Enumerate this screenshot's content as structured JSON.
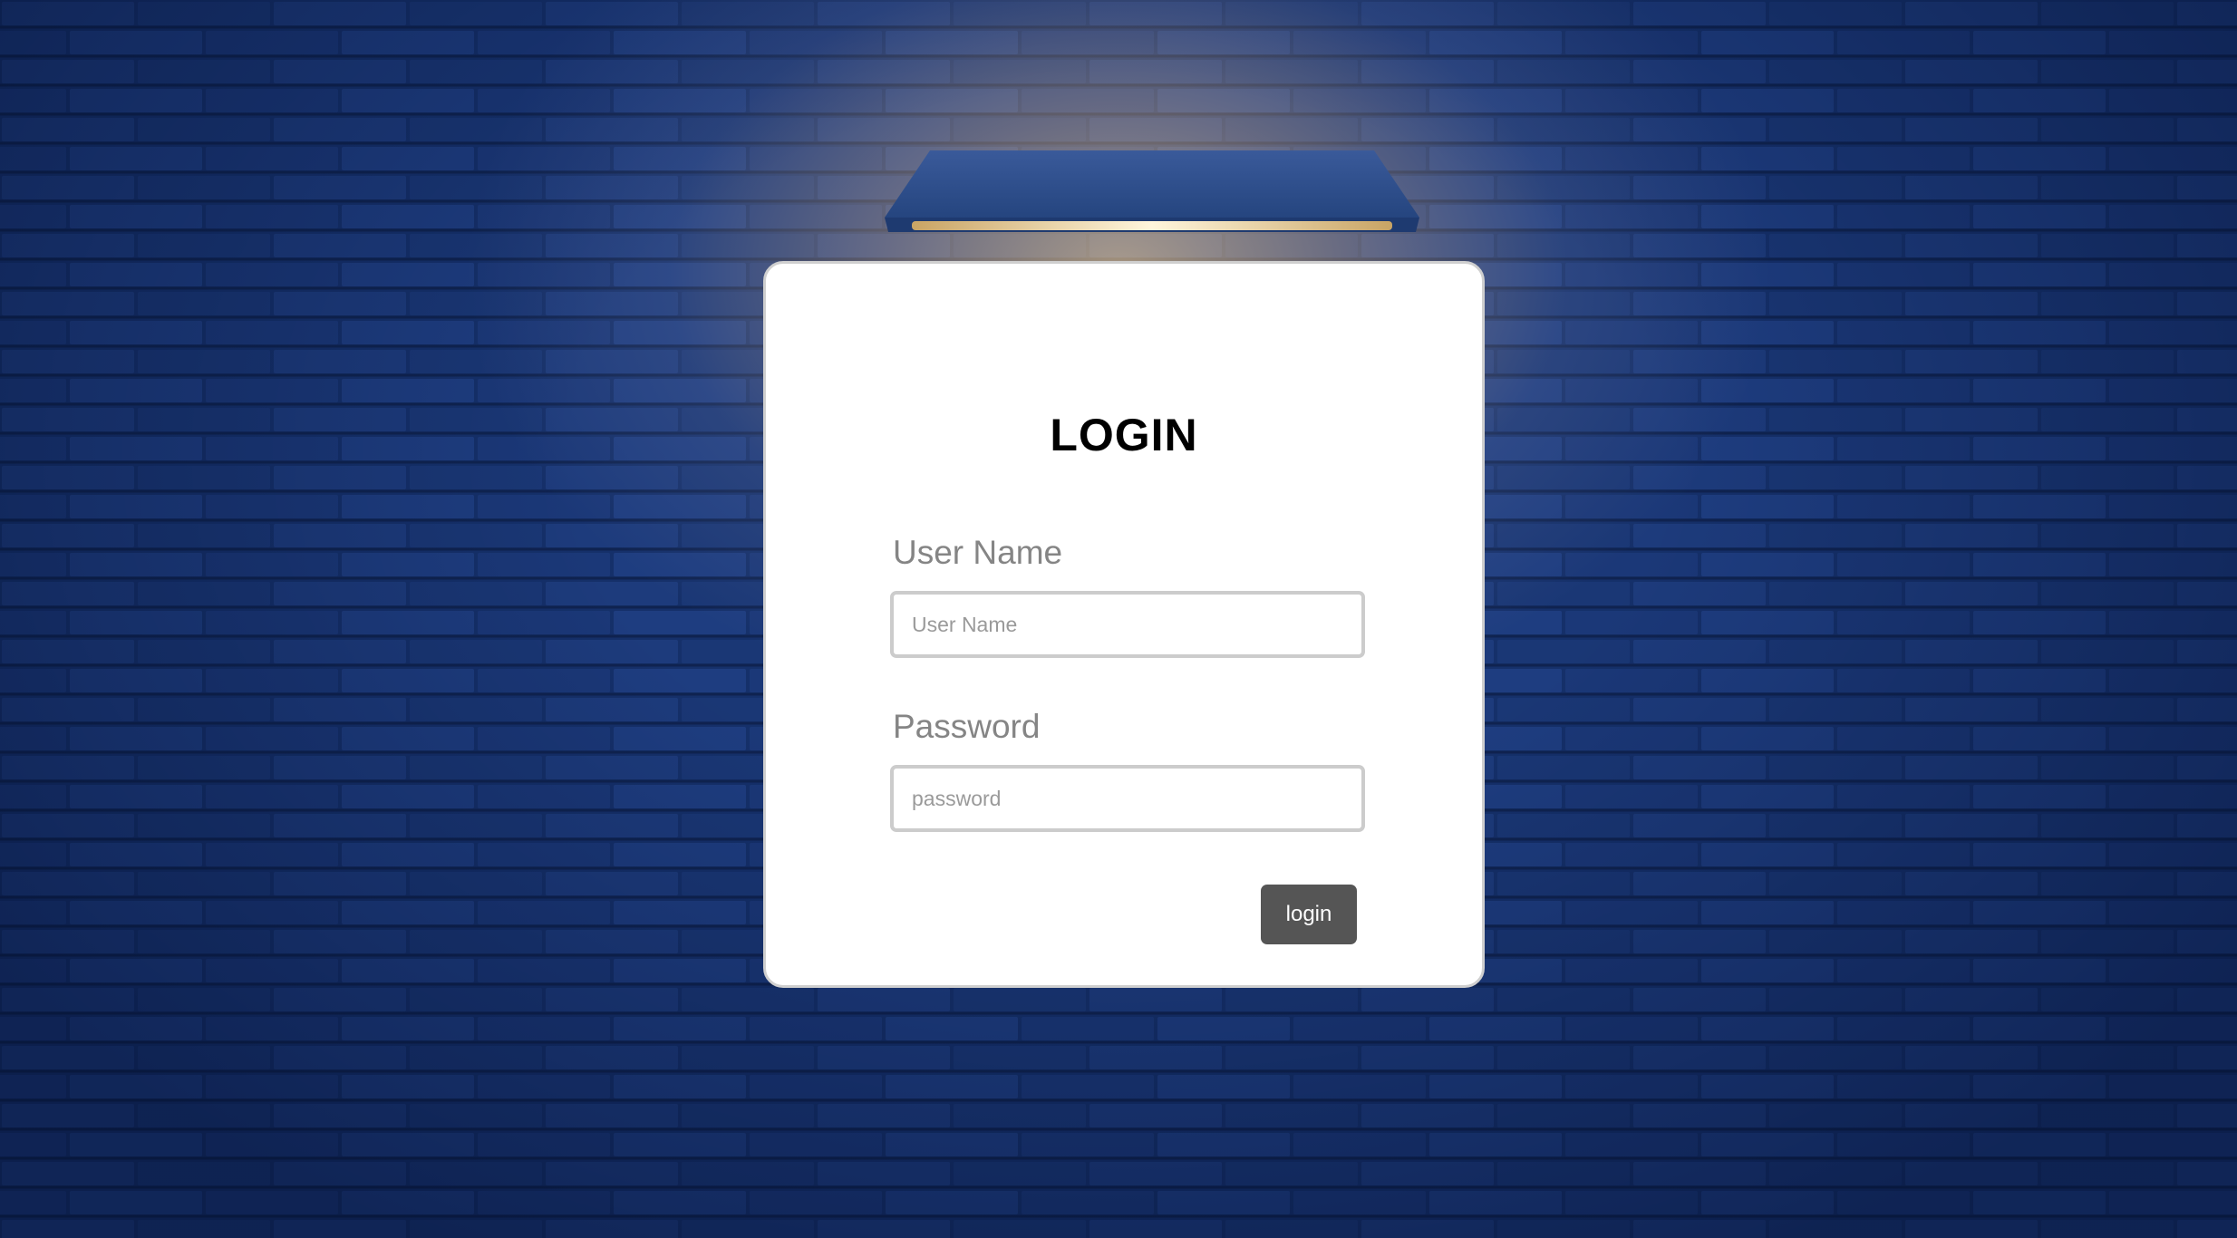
{
  "login_form": {
    "title": "LOGIN",
    "username": {
      "label": "User Name",
      "value": "",
      "placeholder": "User Name"
    },
    "password": {
      "label": "Password",
      "value": "",
      "placeholder": "password"
    },
    "submit_label": "login"
  },
  "colors": {
    "background_wall": "#13295a",
    "card_background": "#ffffff",
    "card_border": "#cfcfcf",
    "title_text": "#000000",
    "label_text": "#858585",
    "input_border": "#cccccc",
    "button_background": "#555555",
    "button_text": "#ffffff",
    "lamp_light": "#ffd696"
  },
  "icons": {
    "lamp": "wall-lamp-icon"
  }
}
